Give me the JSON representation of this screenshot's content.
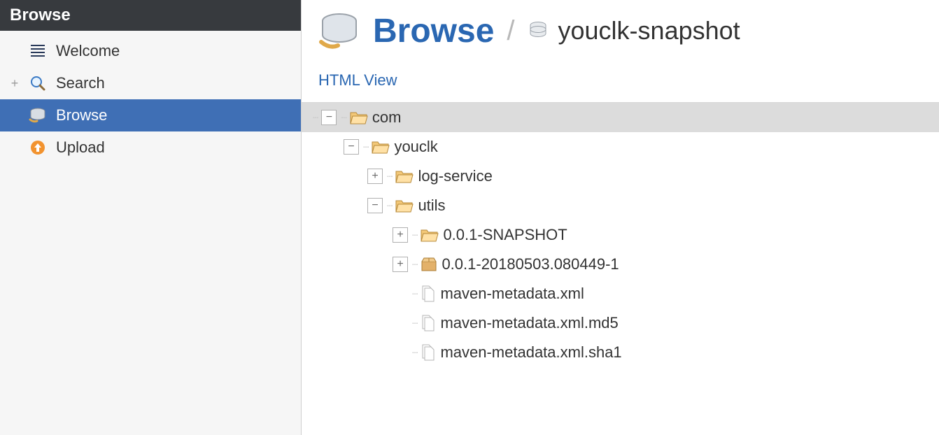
{
  "sidebar": {
    "header": "Browse",
    "items": [
      {
        "label": "Welcome",
        "icon": "welcome"
      },
      {
        "label": "Search",
        "icon": "search",
        "expandable": true
      },
      {
        "label": "Browse",
        "icon": "browse",
        "active": true
      },
      {
        "label": "Upload",
        "icon": "upload"
      }
    ]
  },
  "breadcrumb": {
    "title": "Browse",
    "repo": "youclk-snapshot"
  },
  "links": {
    "html_view": "HTML View"
  },
  "tree": {
    "nodes": [
      {
        "depth": 0,
        "toggle": "minus",
        "icon": "folder-open",
        "label": "com",
        "selected": true
      },
      {
        "depth": 1,
        "toggle": "minus",
        "icon": "folder-open",
        "label": "youclk"
      },
      {
        "depth": 2,
        "toggle": "plus",
        "icon": "folder-open",
        "label": "log-service"
      },
      {
        "depth": 2,
        "toggle": "minus",
        "icon": "folder-open",
        "label": "utils"
      },
      {
        "depth": 3,
        "toggle": "plus",
        "icon": "folder-open",
        "label": "0.0.1-SNAPSHOT"
      },
      {
        "depth": 3,
        "toggle": "plus",
        "icon": "package",
        "label": "0.0.1-20180503.080449-1"
      },
      {
        "depth": 3,
        "toggle": "none",
        "icon": "file",
        "label": "maven-metadata.xml"
      },
      {
        "depth": 3,
        "toggle": "none",
        "icon": "file",
        "label": "maven-metadata.xml.md5"
      },
      {
        "depth": 3,
        "toggle": "none",
        "icon": "file",
        "label": "maven-metadata.xml.sha1"
      }
    ]
  }
}
